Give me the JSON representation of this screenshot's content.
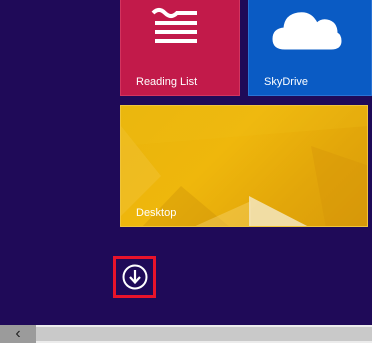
{
  "tiles": {
    "reading_list": {
      "label": "Reading List",
      "icon": "reading-list-icon",
      "color": "#c21a4a"
    },
    "skydrive": {
      "label": "SkyDrive",
      "icon": "cloud-icon",
      "color": "#0a5bc4"
    },
    "desktop": {
      "label": "Desktop",
      "color": "#e9b40b"
    }
  },
  "apps_button": {
    "icon": "arrow-down-circle-icon",
    "highlight_color": "#e8132b"
  },
  "scrollbar": {
    "left_arrow_icon": "chevron-left-icon",
    "left_arrow_glyph": "‹"
  },
  "colors": {
    "background": "#1f0a58"
  }
}
